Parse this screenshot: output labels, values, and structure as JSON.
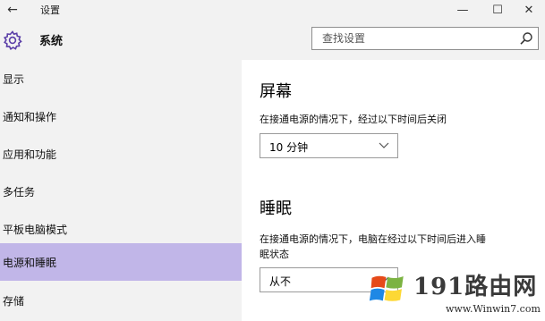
{
  "window": {
    "title": "设置",
    "back_glyph": "←",
    "minimize_glyph": "—",
    "maximize_glyph": "☐",
    "close_glyph": "✕"
  },
  "header": {
    "app_name": "系统",
    "icon": "gear-icon",
    "search": {
      "placeholder": "查找设置",
      "value": "",
      "icon": "search-icon"
    }
  },
  "sidebar": {
    "items": [
      {
        "label": "显示"
      },
      {
        "label": "通知和操作"
      },
      {
        "label": "应用和功能"
      },
      {
        "label": "多任务"
      },
      {
        "label": "平板电脑模式"
      },
      {
        "label": "电源和睡眠",
        "selected": true
      },
      {
        "label": "存储"
      }
    ],
    "selected_color": "#c1b6e8"
  },
  "content": {
    "screen": {
      "title": "屏幕",
      "description": "在接通电源的情况下，经过以下时间后关闭",
      "dropdown_value": "10 分钟"
    },
    "sleep": {
      "title": "睡眠",
      "description_line1": "在接通电源的情况下，电脑在经过以下时间后进入睡",
      "description_line2": "眠状态",
      "dropdown_value": "从不"
    }
  },
  "watermark": {
    "brand": "191路由网",
    "url": "www.Winwin7.com"
  },
  "colors": {
    "background": "#f2f2f2",
    "content_bg": "#ffffff",
    "selected": "#c1b6e8",
    "accent_icon": "#5b3fa8"
  }
}
